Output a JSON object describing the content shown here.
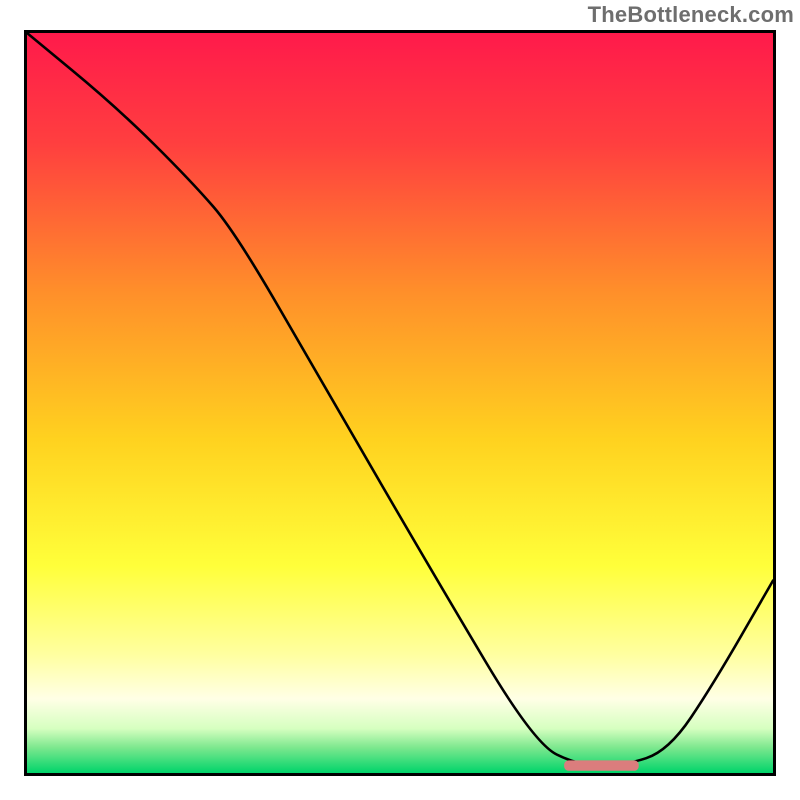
{
  "watermark": "TheBottleneck.com",
  "chart_data": {
    "type": "line",
    "title": "",
    "xlabel": "",
    "ylabel": "",
    "xlim": [
      0,
      100
    ],
    "ylim": [
      0,
      100
    ],
    "grid": false,
    "series": [
      {
        "name": "bottleneck-curve",
        "x": [
          0,
          12,
          22,
          28,
          40,
          55,
          68,
          74,
          80,
          86,
          92,
          100
        ],
        "values": [
          100,
          90,
          80,
          73,
          52,
          26,
          4,
          1,
          1,
          3,
          12,
          26
        ]
      }
    ],
    "marker": {
      "name": "optimal-band",
      "x_start": 72,
      "x_end": 82,
      "y": 1,
      "color": "#db7d7d"
    },
    "background_gradient": {
      "stops": [
        {
          "offset": 0.0,
          "color": "#ff1a4b"
        },
        {
          "offset": 0.15,
          "color": "#ff3f3f"
        },
        {
          "offset": 0.35,
          "color": "#ff8f2a"
        },
        {
          "offset": 0.55,
          "color": "#ffd21f"
        },
        {
          "offset": 0.72,
          "color": "#ffff3a"
        },
        {
          "offset": 0.84,
          "color": "#ffffa0"
        },
        {
          "offset": 0.9,
          "color": "#ffffe6"
        },
        {
          "offset": 0.94,
          "color": "#d6ffc0"
        },
        {
          "offset": 0.965,
          "color": "#7fe88f"
        },
        {
          "offset": 1.0,
          "color": "#00d46a"
        }
      ]
    }
  }
}
